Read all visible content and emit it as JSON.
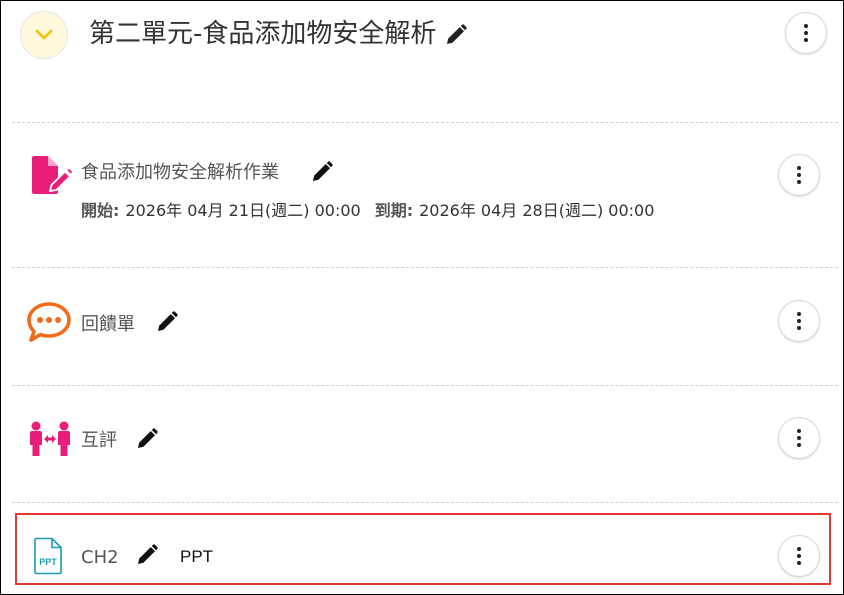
{
  "unit": {
    "title": "第二單元-食品添加物安全解析"
  },
  "items": [
    {
      "label": "食品添加物安全解析作業",
      "start_key": "開始:",
      "start_value": "2026年 04月 21日(週二) 00:00",
      "due_key": "到期:",
      "due_value": "2026年 04月 28日(週二) 00:00"
    },
    {
      "label": "回饋單"
    },
    {
      "label": "互評"
    },
    {
      "label": "CH2",
      "tag": "PPT",
      "icon_text": "PPT"
    }
  ],
  "colors": {
    "assignment_icon": "#e91e7a",
    "feedback_icon": "#ef6c1a",
    "peer_review_icon": "#e91e7a",
    "ppt_icon": "#1a9cb0",
    "highlight_border": "#e53935",
    "collapse_chevron": "#f2c200"
  },
  "icons": {
    "collapse": "chevron-down-icon",
    "edit": "pencil-icon",
    "more": "more-vertical-icon",
    "assignment": "document-edit-icon",
    "feedback": "chat-bubble-icon",
    "peer_review": "peer-review-icon",
    "ppt": "ppt-file-icon"
  }
}
